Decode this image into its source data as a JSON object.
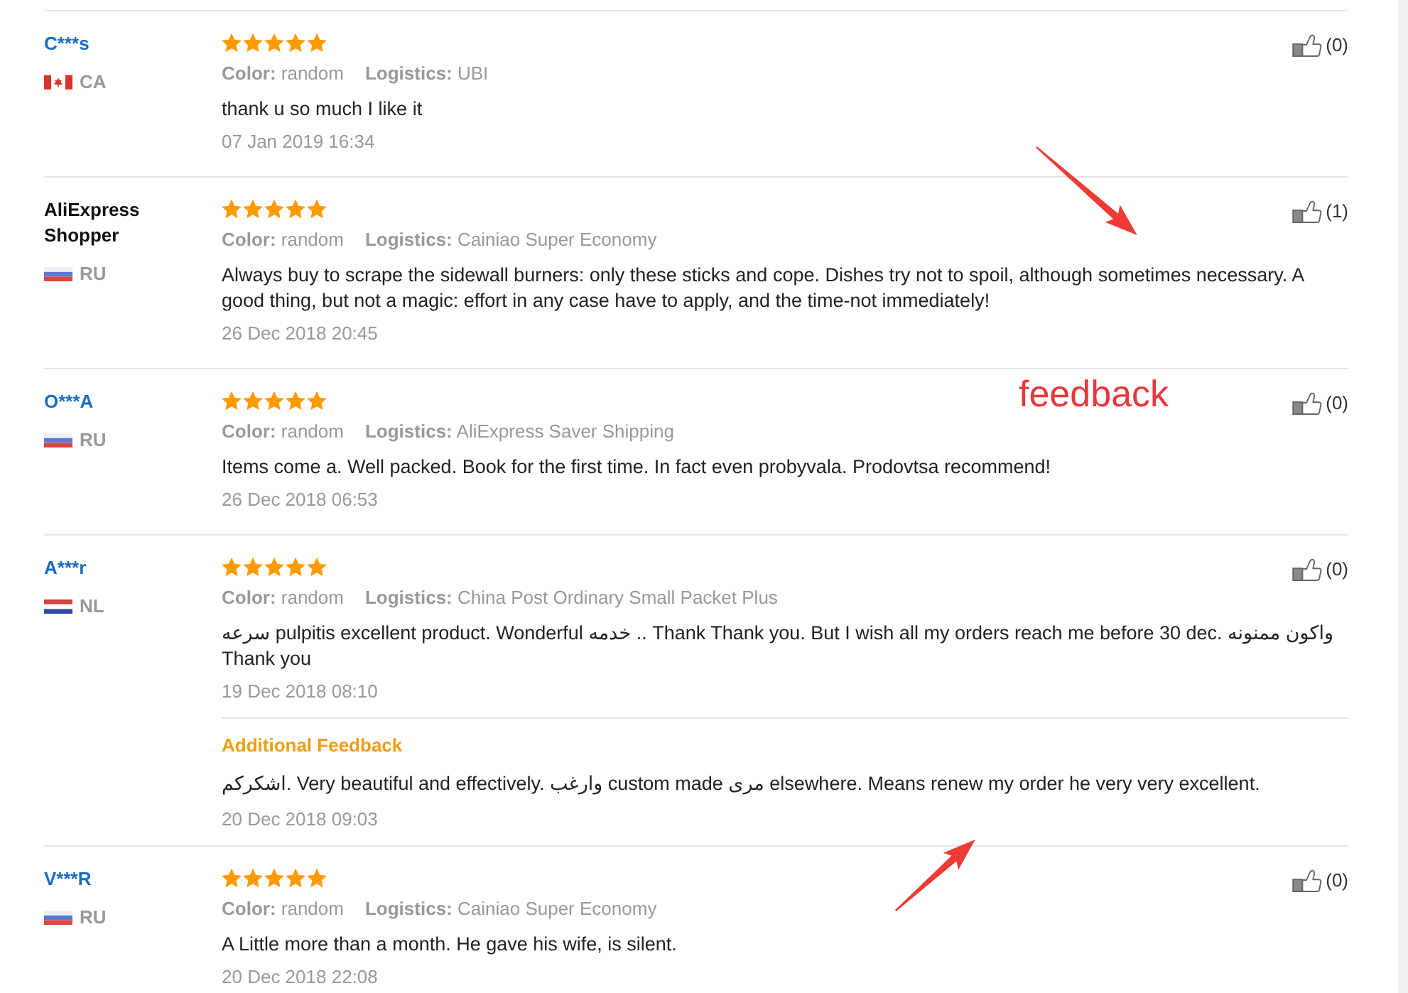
{
  "reviews": [
    {
      "name": "C***s",
      "profile_link": true,
      "country": {
        "kind": "canada",
        "code": "CA"
      },
      "stars": 5,
      "attributes": [
        "**Color:** random",
        "**Logistics:** UBI"
      ],
      "text": "thank u so much I like it",
      "date": "07 Jan 2019 16:34",
      "likes": "(0)"
    },
    {
      "name": "AliExpress Shopper",
      "profile_link": false,
      "country": {
        "kind": "russia",
        "code": "RU"
      },
      "stars": 5,
      "attributes": [
        "**Color:** random",
        "**Logistics:** Cainiao Super Economy"
      ],
      "text": "Always buy to scrape the sidewall burners: only these sticks and cope. Dishes try not to spoil, although sometimes necessary. A good thing, but not a magic: effort in any case have to apply, and the time-not immediately!",
      "date": "26 Dec 2018 20:45",
      "likes": "(1)"
    },
    {
      "name": "O***A",
      "profile_link": true,
      "country": {
        "kind": "russia",
        "code": "RU"
      },
      "stars": 5,
      "attributes": [
        "**Color:** random",
        "**Logistics:** AliExpress Saver Shipping"
      ],
      "text": "Items come a. Well packed. Book for the first time. In fact even probyvala. Prodovtsa recommend!",
      "date": "26 Dec 2018 06:53",
      "likes": "(0)"
    },
    {
      "name": "A***r",
      "profile_link": true,
      "country": {
        "kind": "netherlands",
        "code": "NL"
      },
      "stars": 5,
      "attributes": [
        "**Color:** random",
        "**Logistics:** China Post Ordinary Small Packet Plus"
      ],
      "text": "سرعه pulpitis excellent product. Wonderful خدمه .. Thank Thank you. But I wish all my orders reach me before 30 dec. واكون ممنونه Thank you",
      "date": "19 Dec 2018 08:10",
      "likes": "(0)",
      "additional_feedback": {
        "title": "Additional Feedback",
        "text": "اشكركم. Very beautiful and effectively. وارغب custom made مرى elsewhere. Means renew my order he very very excellent.",
        "date": "20 Dec 2018 09:03"
      }
    },
    {
      "name": "V***R",
      "profile_link": true,
      "country": {
        "kind": "russia",
        "code": "RU"
      },
      "stars": 5,
      "attributes": [
        "**Color:** random",
        "**Logistics:** Cainiao Super Economy"
      ],
      "text": "A Little more than a month. He gave his wife, is silent.",
      "date": "20 Dec 2018 22:08",
      "likes": "(0)"
    }
  ],
  "annotations": [
    {
      "kind": "arrow"
    },
    {
      "kind": "label",
      "text": "feedback"
    },
    {
      "kind": "arrow"
    }
  ]
}
